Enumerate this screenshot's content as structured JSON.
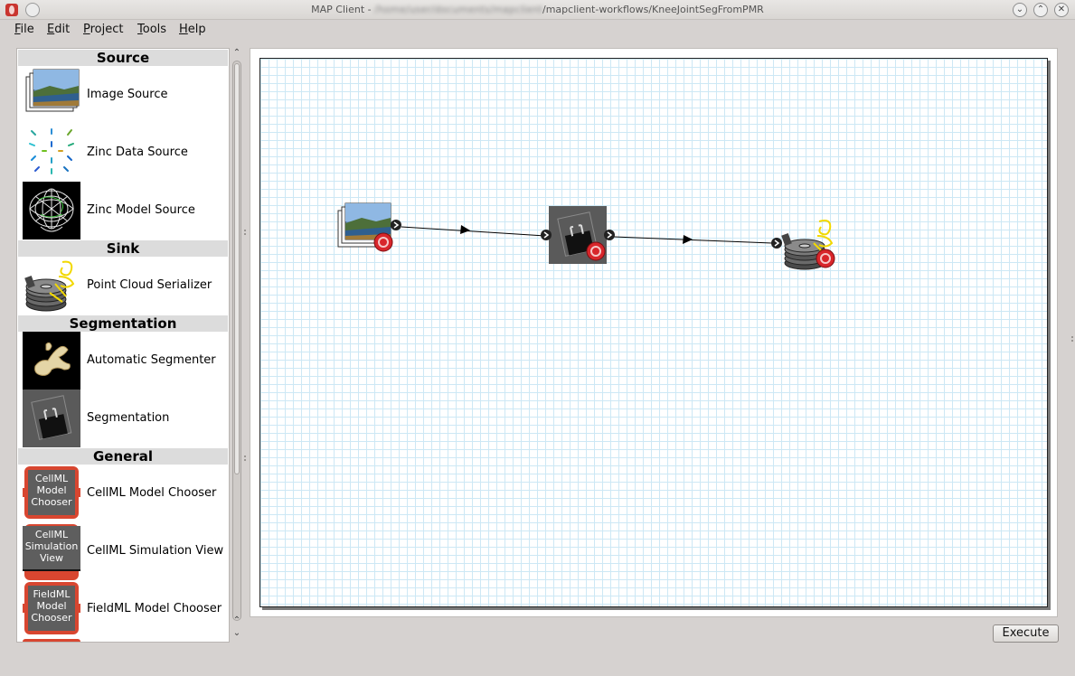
{
  "window": {
    "title_prefix": "MAP Client - ",
    "title_path": "/mapclient-workflows/KneeJointSegFromPMR",
    "controls": {
      "minimize": "⌄",
      "maximize": "⌃",
      "close": "✕"
    }
  },
  "menu": [
    "File",
    "Edit",
    "Project",
    "Tools",
    "Help"
  ],
  "categories": {
    "source": "Source",
    "sink": "Sink",
    "segmentation": "Segmentation",
    "general": "General"
  },
  "steps": {
    "image_source": "Image Source",
    "zinc_data_source": "Zinc Data Source",
    "zinc_model_source": "Zinc Model Source",
    "point_cloud_serializer": "Point Cloud Serializer",
    "automatic_segmenter": "Automatic Segmenter",
    "segmentation": "Segmentation",
    "cellml_model_chooser": "CellML Model Chooser",
    "cellml_simulation_view": "CellML Simulation View",
    "fieldml_model_chooser": "FieldML Model Chooser"
  },
  "step_icon_text": {
    "cellml_model_chooser": [
      "CellML",
      "Model",
      "Chooser"
    ],
    "cellml_simulation_view": [
      "CellML",
      "Simulation",
      "View"
    ],
    "fieldml_model_chooser": [
      "FieldML",
      "Model",
      "Chooser"
    ]
  },
  "execute_label": "Execute",
  "colors": {
    "grid": "#cde8f5",
    "config_badge": "#d8262b",
    "chooser_red": "#d84630"
  }
}
